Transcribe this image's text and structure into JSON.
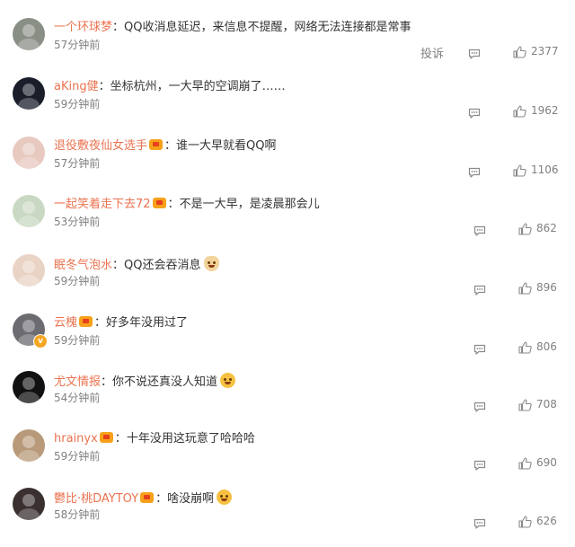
{
  "comments": [
    {
      "username": "一个环球梦",
      "verified_crown": false,
      "v_badge": false,
      "separator": "：",
      "text": "QQ收消息延迟，来信息不提醒，网络无法连接都是常事",
      "emoji": null,
      "time": "57分钟前",
      "report_label": "投诉",
      "likes": "2377",
      "avatar_color": "#8a8f86"
    },
    {
      "username": "aKing健",
      "verified_crown": false,
      "v_badge": false,
      "separator": "：",
      "text": "坐标杭州，一大早的空调崩了……",
      "emoji": null,
      "time": "59分钟前",
      "report_label": null,
      "likes": "1962",
      "avatar_color": "#1a1e2b"
    },
    {
      "username": "退役敷夜仙女选手",
      "verified_crown": true,
      "v_badge": false,
      "separator": "：",
      "text": "谁一大早就看QQ啊",
      "emoji": null,
      "time": "57分钟前",
      "report_label": null,
      "likes": "1106",
      "avatar_color": "#e8c9c0"
    },
    {
      "username": "一起笑着走下去72",
      "verified_crown": true,
      "v_badge": false,
      "separator": "：",
      "text": "不是一大早，是凌晨那会儿",
      "emoji": null,
      "time": "53分钟前",
      "report_label": null,
      "likes": "862",
      "avatar_color": "#c9d8c2"
    },
    {
      "username": "眠冬气泡水",
      "verified_crown": false,
      "v_badge": false,
      "separator": "：",
      "text": "QQ还会吞消息",
      "emoji": "cat-face-emoji",
      "time": "59分钟前",
      "report_label": null,
      "likes": "896",
      "avatar_color": "#e9d3c4"
    },
    {
      "username": "云槐",
      "verified_crown": true,
      "v_badge": true,
      "separator": "：",
      "text": "好多年没用过了",
      "emoji": null,
      "time": "59分钟前",
      "report_label": null,
      "likes": "806",
      "avatar_color": "#6b6b70"
    },
    {
      "username": "尤文情报",
      "verified_crown": false,
      "v_badge": false,
      "separator": "：",
      "text": "你不说还真没人知道",
      "emoji": "laughing-emoji",
      "time": "54分钟前",
      "report_label": null,
      "likes": "708",
      "avatar_color": "#111111"
    },
    {
      "username": "hrainyx",
      "verified_crown": true,
      "v_badge": false,
      "separator": "：",
      "text": "十年没用这玩意了哈哈哈",
      "emoji": null,
      "time": "59分钟前",
      "report_label": null,
      "likes": "690",
      "avatar_color": "#b89a7a"
    },
    {
      "username": "鬱比·桃DAYTOY",
      "verified_crown": true,
      "v_badge": false,
      "separator": "：",
      "text": "啥没崩啊",
      "emoji": "thinking-emoji",
      "time": "58分钟前",
      "report_label": null,
      "likes": "626",
      "avatar_color": "#3a3030"
    }
  ],
  "colors": {
    "username": "#eb7350",
    "meta": "#808080",
    "text": "#333333"
  },
  "icons": {
    "comment": "comment-icon",
    "like": "thumbs-up-icon",
    "crown": "crown-badge-icon",
    "v": "verified-v-icon"
  }
}
